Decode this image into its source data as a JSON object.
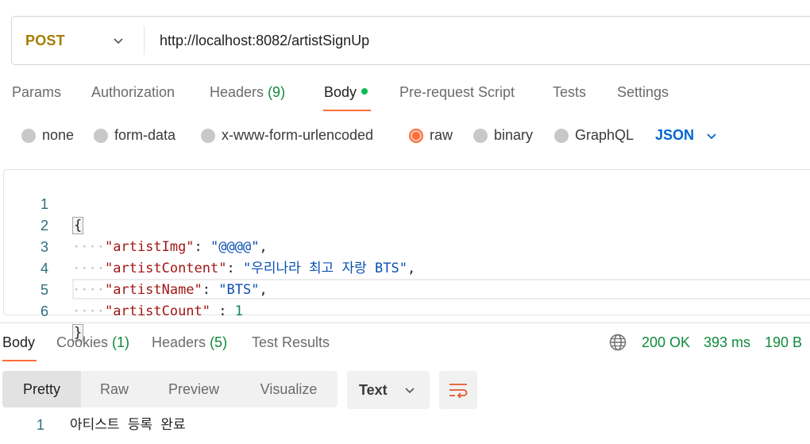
{
  "request": {
    "method": "POST",
    "url": "http://localhost:8082/artistSignUp"
  },
  "request_tabs": {
    "params": "Params",
    "authorization": "Authorization",
    "headers": "Headers",
    "headers_count": "(9)",
    "body": "Body",
    "pre_request": "Pre-request Script",
    "tests": "Tests",
    "settings": "Settings",
    "active": "Body"
  },
  "body_types": {
    "none": "none",
    "form_data": "form-data",
    "urlencoded": "x-www-form-urlencoded",
    "raw": "raw",
    "binary": "binary",
    "graphql": "GraphQL",
    "selected": "raw",
    "language": "JSON"
  },
  "editor": {
    "line_numbers": [
      "1",
      "2",
      "3",
      "4",
      "5",
      "6"
    ],
    "open_brace": "{",
    "close_brace": "}",
    "fields": [
      {
        "key": "\"artistImg\"",
        "sep": ": ",
        "value": "\"@@@@\"",
        "trail": ","
      },
      {
        "key": "\"artistContent\"",
        "sep": ": ",
        "value": "\"우리나라 최고 자랑 BTS\"",
        "trail": ","
      },
      {
        "key": "\"artistName\"",
        "sep": ": ",
        "value": "\"BTS\"",
        "trail": ","
      },
      {
        "key": "\"artistCount\"",
        "sep": " : ",
        "value": "1",
        "trail": ""
      }
    ]
  },
  "response_tabs": {
    "body": "Body",
    "cookies": "Cookies",
    "cookies_count": "(1)",
    "headers": "Headers",
    "headers_count": "(5)",
    "test_results": "Test Results",
    "active": "Body"
  },
  "response_status": {
    "code": "200 OK",
    "time": "393 ms",
    "size": "190 B"
  },
  "view_modes": {
    "pretty": "Pretty",
    "raw": "Raw",
    "preview": "Preview",
    "visualize": "Visualize",
    "active": "Pretty",
    "format": "Text"
  },
  "response_body": {
    "line_number": "1",
    "text": "아티스트 등록 완료"
  },
  "colors": {
    "accent": "#ff6c37",
    "method": "#a67c00",
    "count_green": "#0f8a3c",
    "json_blue": "#0265d2",
    "string_blue": "#0b4fb3",
    "key_red": "#a31515"
  }
}
